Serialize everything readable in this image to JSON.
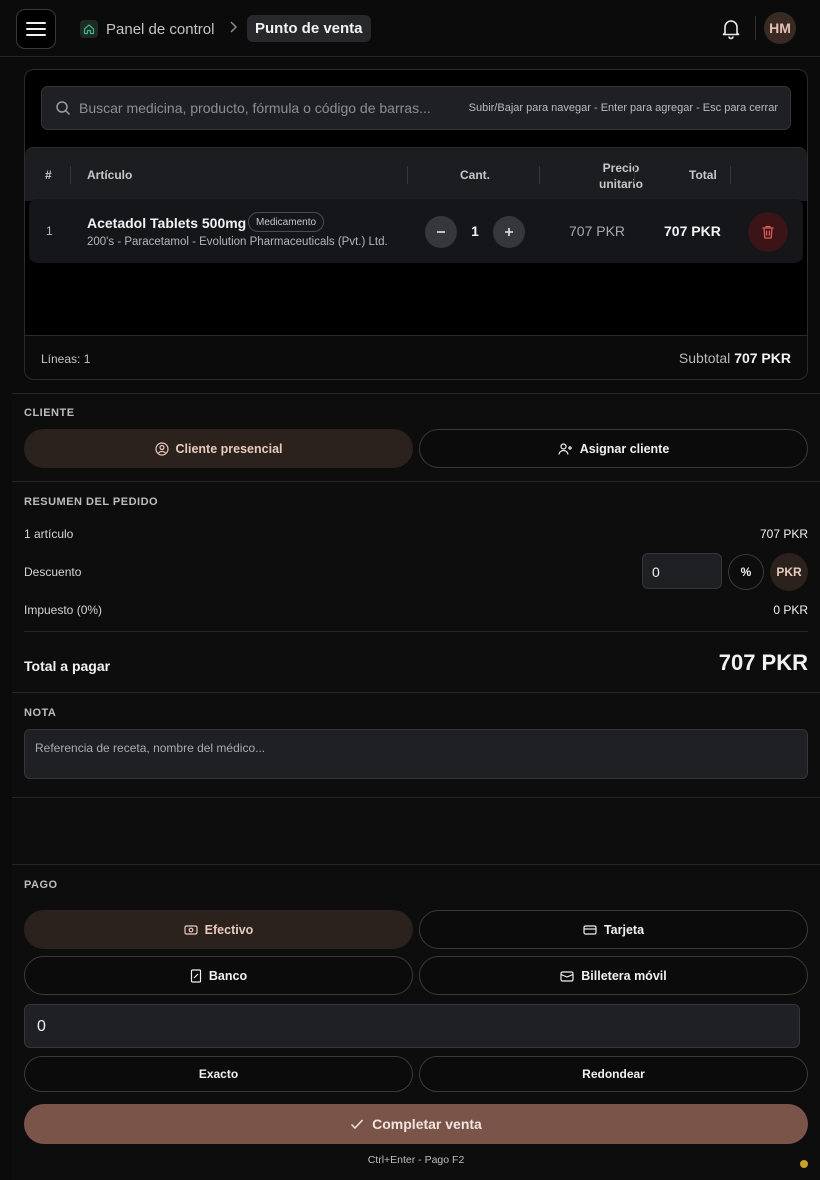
{
  "header": {
    "breadcrumb_home": "Panel de control",
    "breadcrumb_current": "Punto de venta",
    "avatar_initials": "HM"
  },
  "search": {
    "placeholder": "Buscar medicina, producto, fórmula o código de barras...",
    "hint": "Subir/Bajar para navegar - Enter para agregar - Esc para cerrar"
  },
  "cart": {
    "columns": {
      "num": "#",
      "article": "Artículo",
      "qty": "Cant.",
      "unit_price_1": "Precio",
      "unit_price_2": "unitario",
      "total": "Total"
    },
    "items": [
      {
        "num": "1",
        "name": "Acetadol Tablets 500mg",
        "badge": "Medicamento",
        "details": "200's - Paracetamol - Evolution Pharmaceuticals (Pvt.) Ltd.",
        "qty": "1",
        "unit_price": "707 PKR",
        "total": "707 PKR"
      }
    ],
    "lines_label": "Líneas: 1",
    "subtotal_label": "Subtotal",
    "subtotal_value": "707 PKR"
  },
  "client": {
    "label": "CLIENTE",
    "walk_in": "Cliente presencial",
    "assign": "Asignar cliente"
  },
  "summary": {
    "label": "RESUMEN DEL PEDIDO",
    "items_label": "1 artículo",
    "items_value": "707 PKR",
    "discount_label": "Descuento",
    "discount_value": "0",
    "percent_btn": "%",
    "currency_btn": "PKR",
    "tax_label": "Impuesto (0%)",
    "tax_value": "0 PKR",
    "total_label": "Total a pagar",
    "total_value": "707 PKR"
  },
  "note": {
    "label": "NOTA",
    "placeholder": "Referencia de receta, nombre del médico..."
  },
  "payment": {
    "label": "PAGO",
    "methods": [
      "Efectivo",
      "Tarjeta",
      "Banco",
      "Billetera móvil"
    ],
    "amount": "0",
    "exact": "Exacto",
    "round": "Redondear",
    "complete": "Completar venta",
    "shortcut_hint": "Ctrl+Enter - Pago F2"
  },
  "colors": {
    "accent": "#7a5449",
    "active_pill": "#2b211d",
    "danger": "#e05a5a",
    "home_icon": "#3fb48a"
  }
}
